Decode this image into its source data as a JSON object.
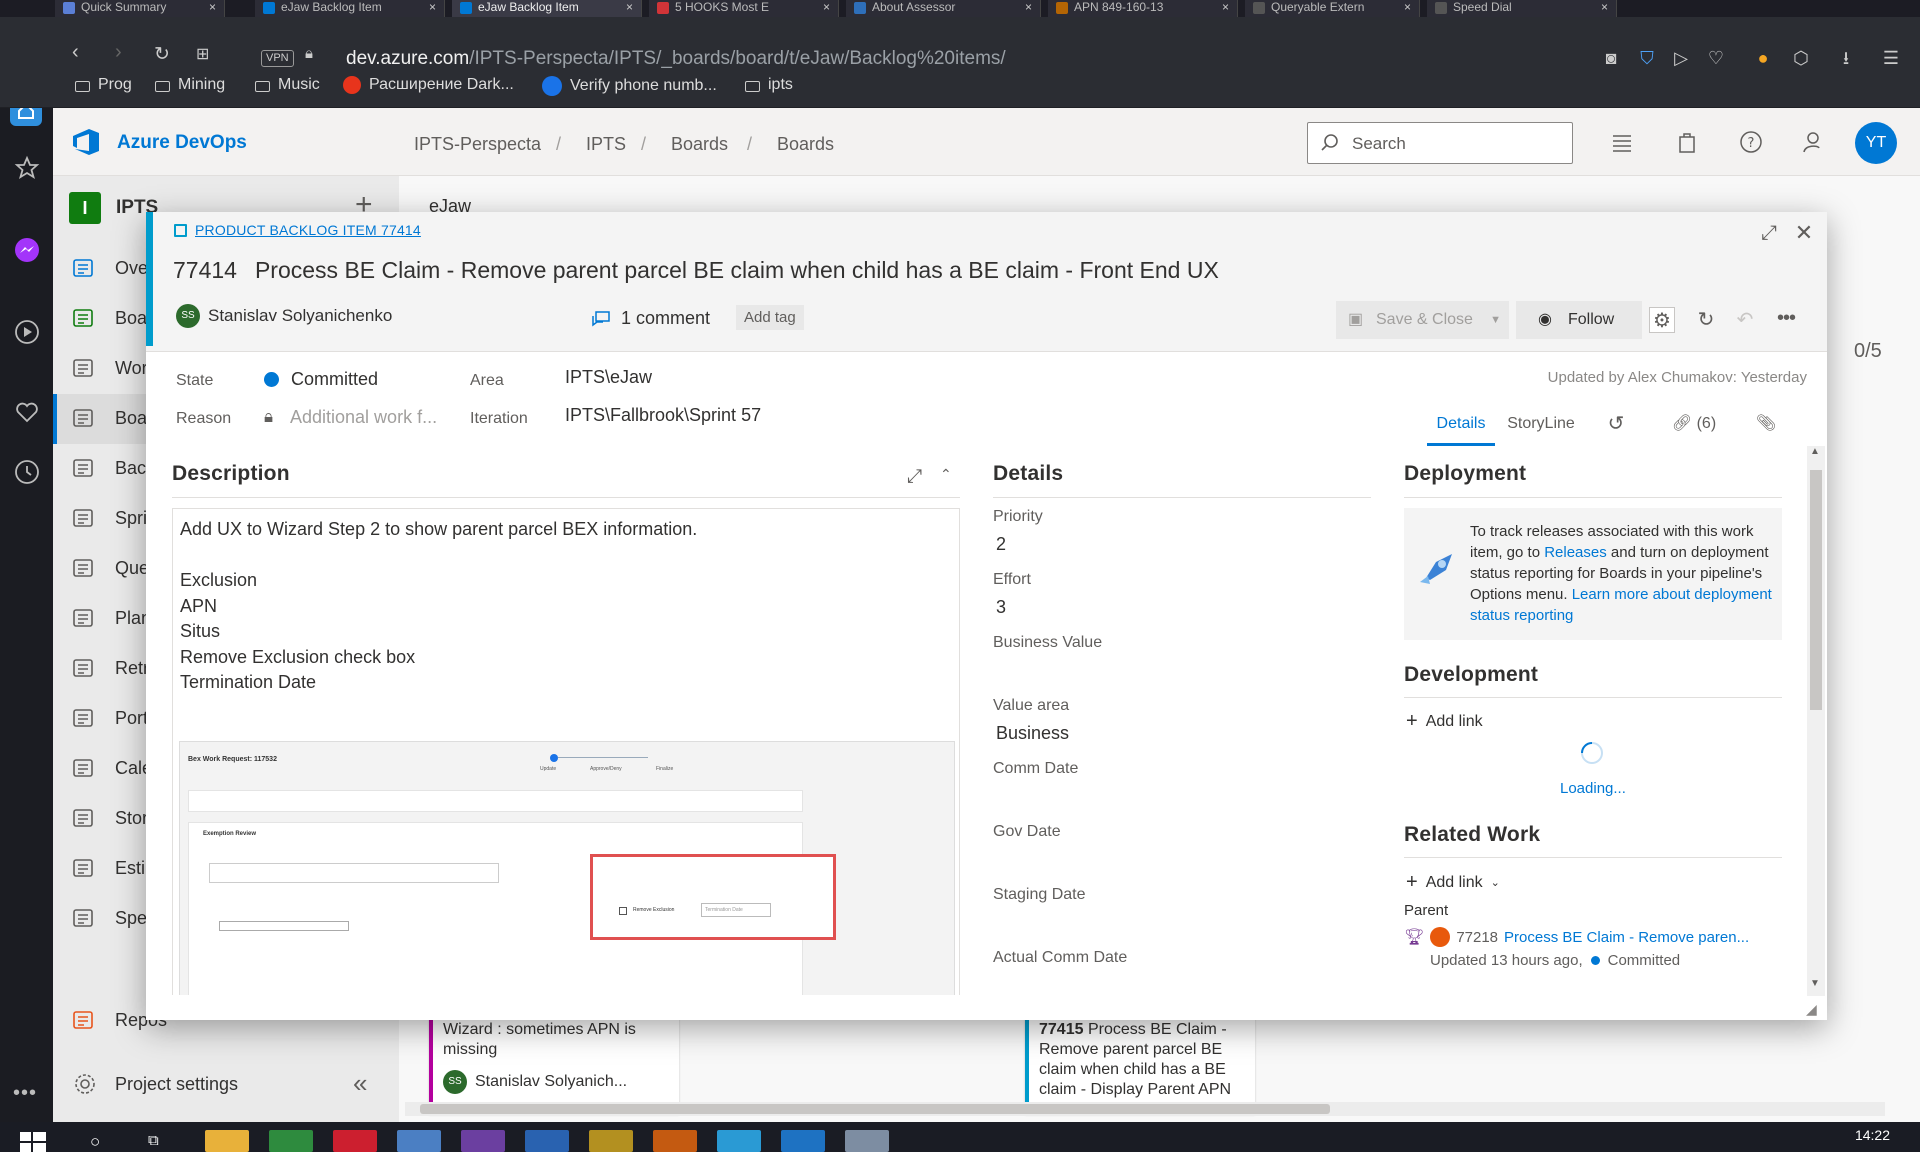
{
  "browser": {
    "tabs": [
      {
        "label": "Quick Summary",
        "color": "#5b7fd6"
      },
      {
        "label": "eJaw Backlog Item",
        "color": "#0078d4"
      },
      {
        "label": "eJaw Backlog Item",
        "color": "#0078d4",
        "active": true
      },
      {
        "label": "5 HOOKS Most E",
        "color": "#d13438"
      },
      {
        "label": "About Assessor",
        "color": "#2e6fba"
      },
      {
        "label": "APN 849-160-13",
        "color": "#b46504"
      },
      {
        "label": "Queryable Extern",
        "color": "#555"
      },
      {
        "label": "Speed Dial",
        "color": "#555"
      }
    ],
    "vpn": "VPN",
    "url_domain": "dev.azure.com",
    "url_path": "/IPTS-Perspecta/IPTS/_boards/board/t/eJaw/Backlog%20items/",
    "bookmarks": [
      "Prog",
      "Mining",
      "Music",
      "Расширение Dark...",
      "Verify phone numb...",
      "ipts"
    ]
  },
  "azure": {
    "brand": "Azure DevOps",
    "breadcrumb": [
      "IPTS-Perspecta",
      "IPTS",
      "Boards",
      "Boards"
    ],
    "search_placeholder": "Search",
    "avatar_initials": "YT",
    "accent": "#0078d4"
  },
  "leftnav": {
    "project": "IPTS",
    "project_initial": "I",
    "items": [
      {
        "label": "Overview",
        "icon": "overview-icon"
      },
      {
        "label": "Boards",
        "icon": "boards-icon"
      },
      {
        "label": "Work items",
        "icon": "work-items-icon"
      },
      {
        "label": "Boards",
        "icon": "board-grid-icon"
      },
      {
        "label": "Backlogs",
        "icon": "backlogs-icon"
      },
      {
        "label": "Sprints",
        "icon": "sprints-icon"
      },
      {
        "label": "Queries",
        "icon": "queries-icon"
      },
      {
        "label": "Plans",
        "icon": "plans-icon"
      },
      {
        "label": "Retrospectives",
        "icon": "retrospectives-icon"
      },
      {
        "label": "Portfolio",
        "icon": "portfolio-icon"
      },
      {
        "label": "Calendar",
        "icon": "calendar-icon"
      },
      {
        "label": "Story Map",
        "icon": "story-map-icon"
      },
      {
        "label": "Estimate",
        "icon": "estimate-icon"
      },
      {
        "label": "Spec",
        "icon": "spec-icon"
      },
      {
        "label": "Repos",
        "icon": "repos-icon"
      }
    ],
    "project_settings": "Project settings"
  },
  "board": {
    "header_name": "eJaw",
    "counter": "0/5",
    "card1_text": "Wizard : sometimes APN is missing",
    "card1_assignee": "Stanislav Solyanich...",
    "card2_id": "77415",
    "card2_text": "Process BE Claim - Remove parent parcel BE claim when child has a BE claim - Display Parent APN BEX info"
  },
  "workitem": {
    "type_label": "PRODUCT BACKLOG ITEM 77414",
    "id": "77414",
    "title": "Process BE Claim - Remove parent parcel BE claim when child has a BE claim - Front End UX",
    "assignee": "Stanislav Solyanichenko",
    "assignee_initials": "SS",
    "comments": "1 comment",
    "add_tag": "Add tag",
    "save_close": "Save & Close",
    "follow": "Follow",
    "state_label": "State",
    "state_value": "Committed",
    "state_color": "#0078d4",
    "reason_label": "Reason",
    "reason_value": "Additional work f...",
    "area_label": "Area",
    "area_value": "IPTS\\eJaw",
    "iteration_label": "Iteration",
    "iteration_value": "IPTS\\Fallbrook\\Sprint 57",
    "updated": "Updated by Alex Chumakov: Yesterday",
    "tabs": [
      "Details",
      "StoryLine",
      "(6)"
    ],
    "description_heading": "Description",
    "description_lines": [
      "Add UX to Wizard Step 2 to show parent parcel BEX information.",
      "",
      "Exclusion",
      "APN",
      "Situs",
      "Remove Exclusion check box",
      "Termination Date"
    ],
    "details_heading": "Details",
    "details": [
      {
        "label": "Priority",
        "value": "2"
      },
      {
        "label": "Effort",
        "value": "3"
      },
      {
        "label": "Business Value",
        "value": ""
      },
      {
        "label": "Value area",
        "value": "Business"
      },
      {
        "label": "Comm Date",
        "value": ""
      },
      {
        "label": "Gov Date",
        "value": ""
      },
      {
        "label": "Staging Date",
        "value": ""
      },
      {
        "label": "Actual Comm Date",
        "value": ""
      }
    ],
    "deployment_heading": "Deployment",
    "deployment_text_1": "To track releases associated with this work item, go to ",
    "deployment_link_1": "Releases",
    "deployment_text_2": " and turn on deployment status reporting for Boards in your pipeline's Options menu. ",
    "deployment_link_2": "Learn more about deployment status reporting",
    "development_heading": "Development",
    "add_link": "Add link",
    "loading": "Loading...",
    "related_heading": "Related Work",
    "parent_label": "Parent",
    "parent_id": "77218",
    "parent_title": "Process BE Claim - Remove paren...",
    "parent_updated": "Updated 13 hours ago,",
    "parent_state": "Committed"
  },
  "screenshot_embed": {
    "title": "Bex Work Request: 117532",
    "section": "Exemption Review",
    "checkbox_label": "Remove Exclusion",
    "date_placeholder": "Termination Date",
    "steps": [
      "Update",
      "Approve/Deny",
      "Finalize"
    ]
  },
  "taskbar": {
    "time": "14:22"
  }
}
